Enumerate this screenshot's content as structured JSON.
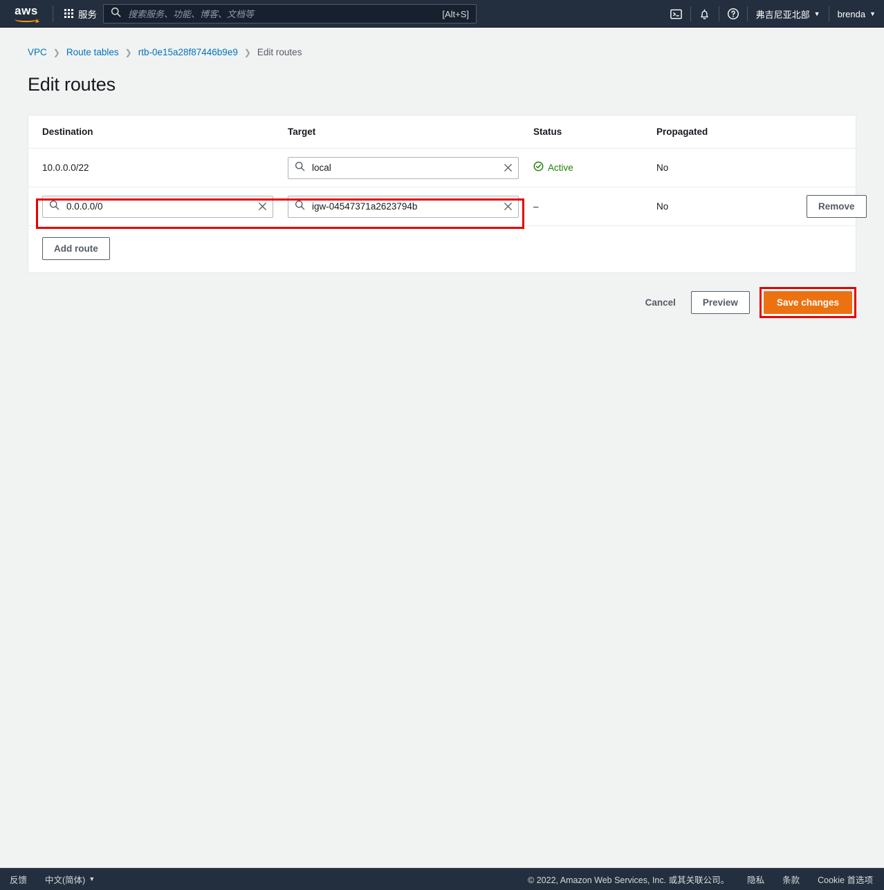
{
  "topnav": {
    "logo_text": "aws",
    "services_label": "服务",
    "search": {
      "placeholder": "搜索服务、功能、博客、文档等",
      "value": "",
      "shortcut": "[Alt+S]"
    },
    "cloudshell_icon": "cloudshell-icon",
    "notifications_icon": "bell-icon",
    "help_icon": "help-icon",
    "region_label": "弗吉尼亚北部",
    "account_label": "brenda",
    "caret": "▼"
  },
  "breadcrumb": {
    "items": [
      {
        "label": "VPC",
        "link": true
      },
      {
        "label": "Route tables",
        "link": true
      },
      {
        "label": "rtb-0e15a28f87446b9e9",
        "link": true
      },
      {
        "label": "Edit routes",
        "link": false
      }
    ],
    "separator": "❯"
  },
  "page": {
    "title": "Edit routes"
  },
  "table": {
    "headers": {
      "destination": "Destination",
      "target": "Target",
      "status": "Status",
      "propagated": "Propagated"
    },
    "rows": [
      {
        "destination_text": "10.0.0.0/22",
        "destination_editable": false,
        "target_value": "igw-local",
        "target_display": "local",
        "status": "Active",
        "status_type": "active",
        "propagated": "No",
        "has_remove": false,
        "remove_label": ""
      },
      {
        "destination_text": "0.0.0.0/0",
        "destination_editable": true,
        "target_value": "igw-04547371a2623794b",
        "target_display": "igw-04547371a2623794b",
        "status": "–",
        "status_type": "none",
        "propagated": "No",
        "has_remove": true,
        "remove_label": "Remove"
      }
    ],
    "add_route_label": "Add route"
  },
  "actions": {
    "cancel_label": "Cancel",
    "preview_label": "Preview",
    "save_label": "Save changes"
  },
  "footer": {
    "feedback_label": "反馈",
    "language_label": "中文(简体)",
    "language_caret": "▼",
    "copyright": "© 2022, Amazon Web Services, Inc. 或其关联公司。",
    "privacy_label": "隐私",
    "terms_label": "条款",
    "cookie_label": "Cookie 首选项"
  },
  "colors": {
    "nav_bg": "#232f3e",
    "page_bg": "#f1f3f3",
    "link": "#0073bb",
    "accent_orange": "#ec7211",
    "status_green": "#1d8102",
    "highlight_red": "#e50000"
  }
}
